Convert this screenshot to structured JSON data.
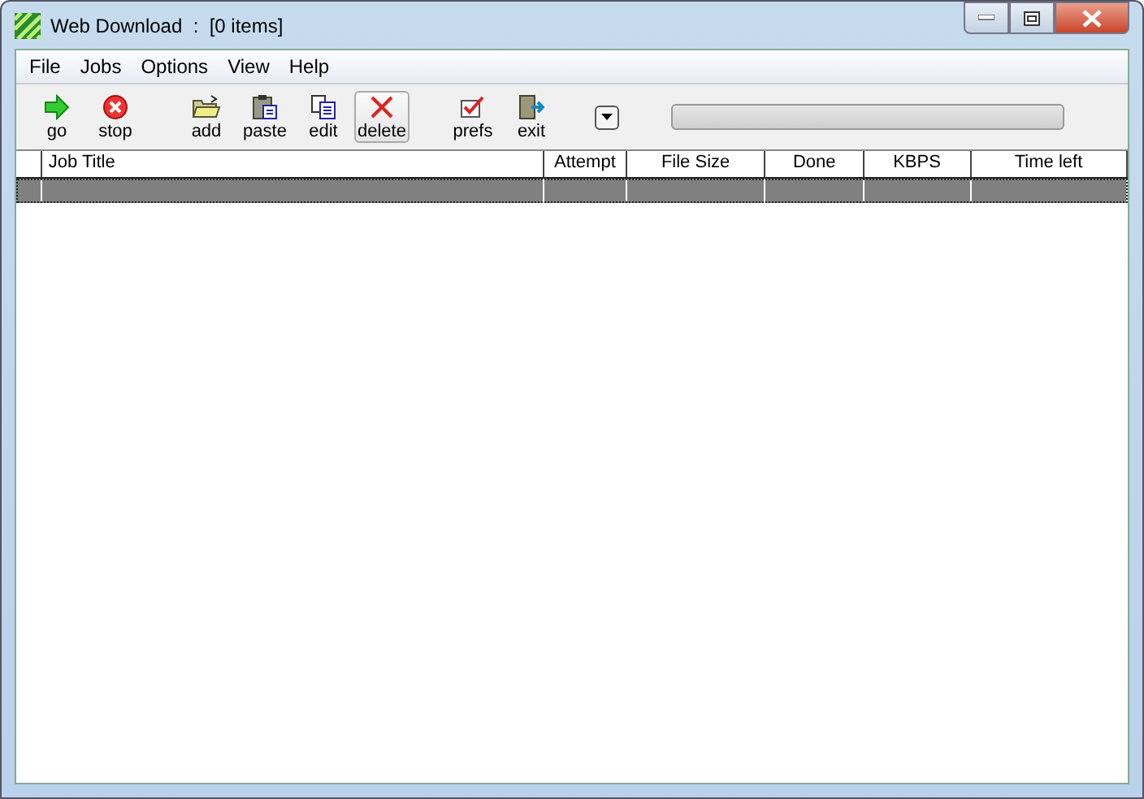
{
  "window": {
    "title": "Web Download  :  [0 items]"
  },
  "menu": [
    "File",
    "Jobs",
    "Options",
    "View",
    "Help"
  ],
  "toolbar": [
    {
      "kind": "go",
      "label": "go",
      "selected": false
    },
    {
      "kind": "stop",
      "label": "stop",
      "selected": false
    },
    {
      "kind": "gap"
    },
    {
      "kind": "add",
      "label": "add",
      "selected": false
    },
    {
      "kind": "paste",
      "label": "paste",
      "selected": false
    },
    {
      "kind": "edit",
      "label": "edit",
      "selected": false
    },
    {
      "kind": "delete",
      "label": "delete",
      "selected": true
    },
    {
      "kind": "gap"
    },
    {
      "kind": "prefs",
      "label": "prefs",
      "selected": false
    },
    {
      "kind": "exit",
      "label": "exit",
      "selected": false
    }
  ],
  "progress": {
    "level": 0
  },
  "table": {
    "columns": [
      "Job Title",
      "Attempt",
      "File Size",
      "Done",
      "KBPS",
      "Time left"
    ],
    "rows": [
      {
        "selected": true
      }
    ]
  }
}
